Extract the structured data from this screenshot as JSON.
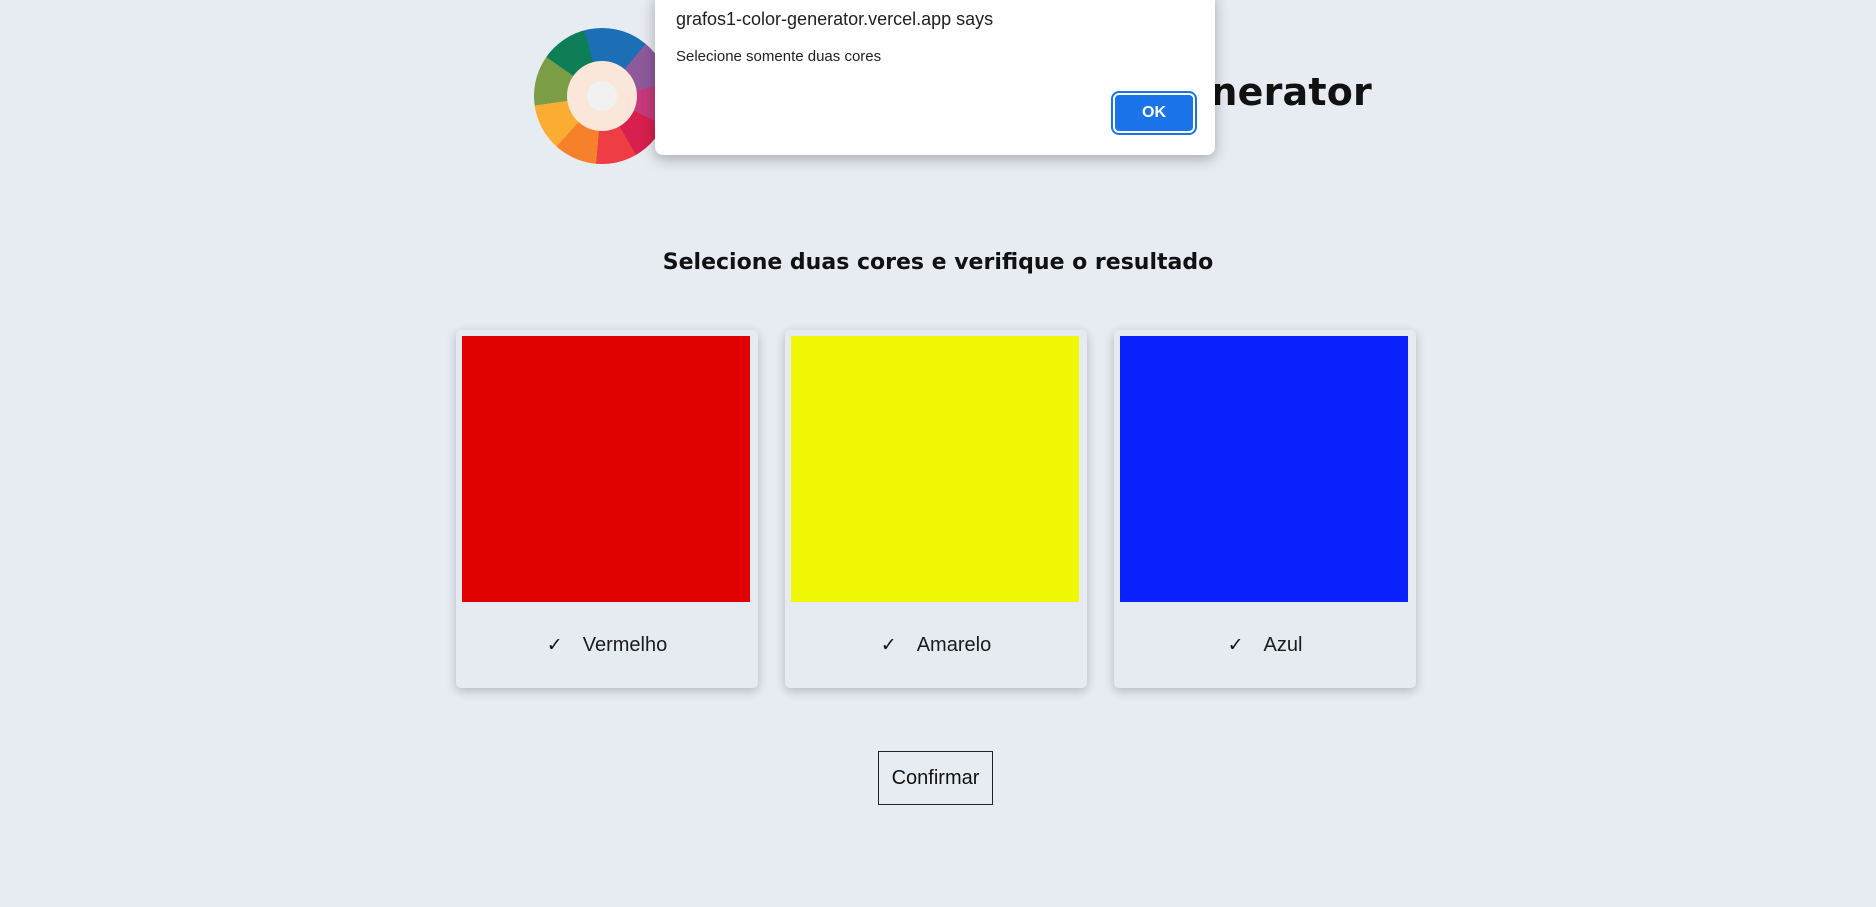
{
  "header": {
    "title": "Color Generator",
    "logo_icon": "color-wheel-logo"
  },
  "main": {
    "subtitle": "Selecione duas cores e verifique o resultado",
    "cards": [
      {
        "label": "Vermelho",
        "color": "#e00000",
        "checked": true,
        "check_glyph": "✓"
      },
      {
        "label": "Amarelo",
        "color": "#f0f806",
        "checked": true,
        "check_glyph": "✓"
      },
      {
        "label": "Azul",
        "color": "#0a21fd",
        "checked": true,
        "check_glyph": "✓"
      }
    ],
    "confirm_label": "Confirmar"
  },
  "dialog": {
    "title": "grafos1-color-generator.vercel.app says",
    "message": "Selecione somente duas cores",
    "ok_label": "OK",
    "accent": "#1a73e8"
  },
  "colors": {
    "background": "#e7ebf2",
    "card": "#e6eaf1"
  }
}
